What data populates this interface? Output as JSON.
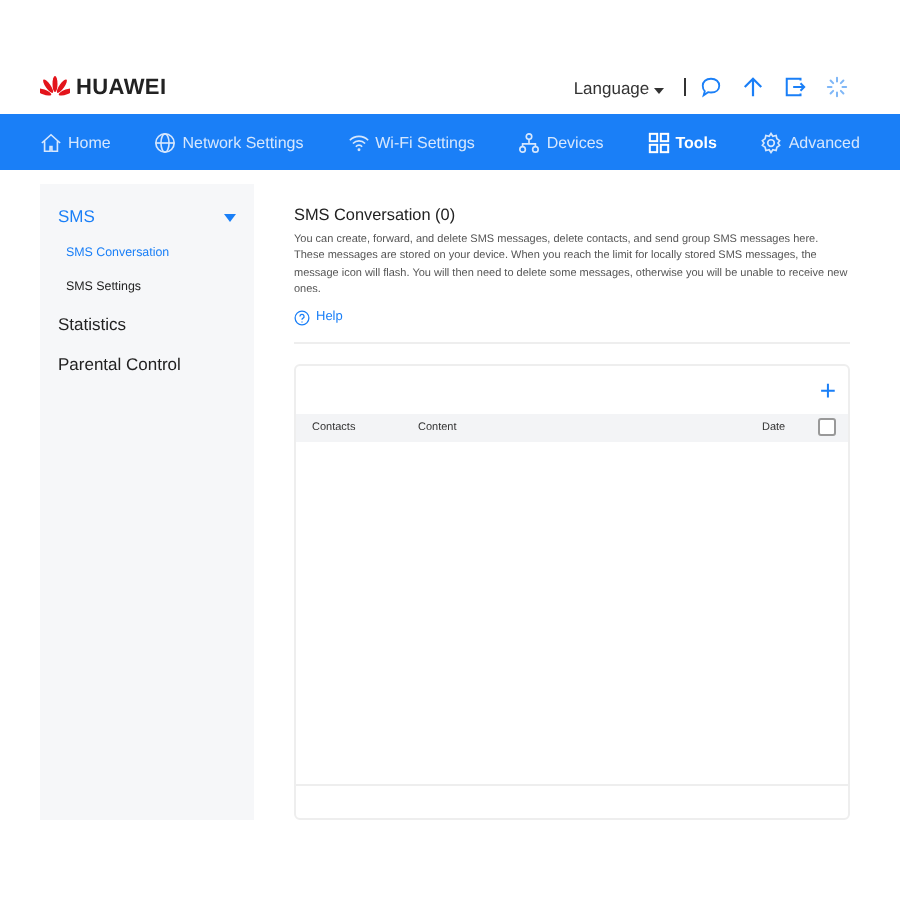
{
  "header": {
    "brand": "HUAWEI",
    "language": "Language"
  },
  "nav": [
    {
      "label": "Home",
      "kind": "home",
      "selected": false
    },
    {
      "label": "Network Settings",
      "kind": "network",
      "selected": false
    },
    {
      "label": "Wi-Fi Settings",
      "kind": "wifi",
      "selected": false
    },
    {
      "label": "Devices",
      "kind": "devices",
      "selected": false
    },
    {
      "label": "Tools",
      "kind": "tools",
      "selected": true
    },
    {
      "label": "Advanced",
      "kind": "advanced",
      "selected": false
    }
  ],
  "sidebar": {
    "items": [
      {
        "label": "SMS",
        "expanded": true,
        "selected": true,
        "children": [
          {
            "label": "SMS Conversation",
            "selected": true
          },
          {
            "label": "SMS Settings",
            "selected": false
          }
        ]
      },
      {
        "label": "Statistics",
        "selected": false
      },
      {
        "label": "Parental Control",
        "selected": false
      }
    ]
  },
  "content": {
    "title": "SMS Conversation (0)",
    "description": "You can create, forward, and delete SMS messages, delete contacts, and send group SMS messages here. These messages are stored on your device. When you reach the limit for locally stored SMS messages, the message icon will flash. You will then need to delete some messages, otherwise you will be unable to receive new ones.",
    "help": "Help"
  },
  "table": {
    "add": "+",
    "columns": [
      "Contacts",
      "Content",
      "Date"
    ],
    "select_all": {
      "checked": false
    }
  }
}
